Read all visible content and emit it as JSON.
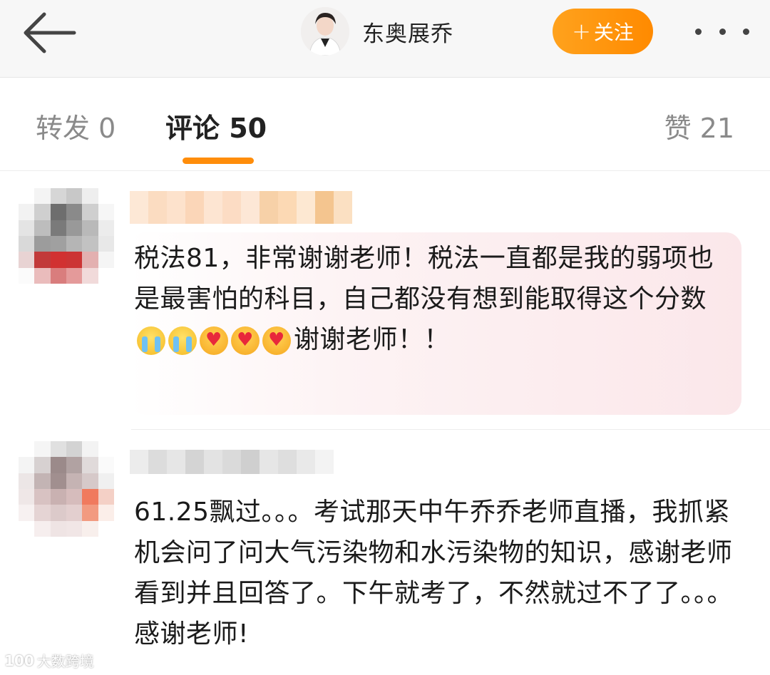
{
  "header": {
    "back_icon": "arrow-left-icon",
    "author_name": "东奥展乔",
    "follow_label": "关注",
    "follow_plus": "+",
    "more_icon": "more-dots-icon",
    "accent_color": "#ff8d0a"
  },
  "tabs": {
    "forward": "转发 0",
    "comments": "评论 50",
    "likes": "赞 21",
    "active": "comments"
  },
  "comments": [
    {
      "username_blurred": true,
      "text_before_emoji": "税法81，非常谢谢老师！税法一直都是我的弱项也是最害怕的科目，自己都没有想到能取得这个分数",
      "emojis": [
        "crying-emoji",
        "crying-emoji",
        "heart-hug-emoji",
        "heart-hug-emoji",
        "heart-hug-emoji"
      ],
      "text_after_emoji": "谢谢老师！！"
    },
    {
      "username_blurred": true,
      "text": "61.25飘过。。。考试那天中午乔乔老师直播，我抓紧机会问了问大气污染物和水污染物的知识，感谢老师看到并且回答了。下午就考了，不然就过不了了。。。感谢老师!"
    }
  ],
  "watermark": {
    "logo": "100",
    "text": "大数跨境"
  }
}
